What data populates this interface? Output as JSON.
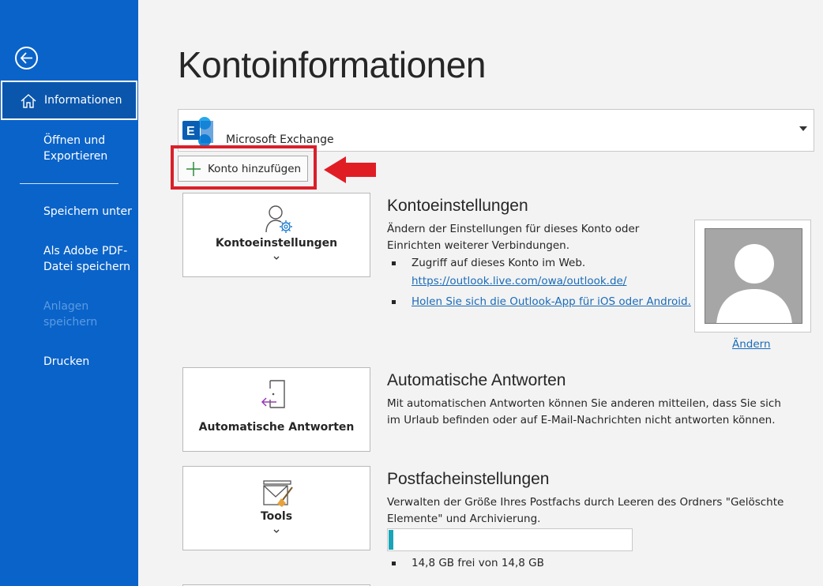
{
  "sidebar": {
    "active_item": "Informationen",
    "items": [
      {
        "label": "Öffnen und Exportieren"
      },
      {
        "label": "Speichern unter"
      },
      {
        "label": "Als Adobe PDF-Datei speichern"
      },
      {
        "label": "Anlagen speichern"
      },
      {
        "label": "Drucken"
      }
    ]
  },
  "page": {
    "title": "Kontoinformationen"
  },
  "account": {
    "name": "Microsoft Exchange",
    "icon": "exchange-icon",
    "add_account_label": "Konto hinzufügen"
  },
  "sections": {
    "account_settings": {
      "tile_label": "Kontoeinstellungen",
      "title": "Kontoeinstellungen",
      "description": "Ändern der Einstellungen für dieses Konto oder Einrichten weiterer Verbindungen.",
      "bullet1": "Zugriff auf dieses Konto im Web.",
      "web_link": "https://outlook.live.com/owa/outlook.de/",
      "app_link": "Holen Sie sich die Outlook-App für iOS oder Android.",
      "change_label": "Ändern"
    },
    "auto_reply": {
      "tile_label": "Automatische Antworten",
      "title": "Automatische Antworten",
      "description": "Mit automatischen Antworten können Sie anderen mitteilen, dass Sie sich im Urlaub befinden oder auf E-Mail-Nachrichten nicht antworten können."
    },
    "mailbox": {
      "tile_label": "Tools",
      "title": "Postfacheinstellungen",
      "description": "Verwalten der Größe Ihres Postfachs durch Leeren des Ordners \"Gelöschte Elemente\" und Archivierung.",
      "usage_fraction": 0.02,
      "storage_text": "14,8 GB frei von 14,8 GB"
    }
  },
  "colors": {
    "sidebar": "#0a63c9",
    "highlight": "#d9202a",
    "link": "#1a6bb8",
    "progress": "#1aa4b8"
  }
}
